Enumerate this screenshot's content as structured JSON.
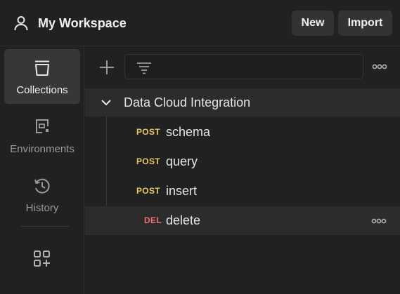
{
  "header": {
    "workspace_icon": "user-icon",
    "title": "My Workspace",
    "new_label": "New",
    "import_label": "Import"
  },
  "rail": {
    "items": [
      {
        "label": "Collections",
        "icon": "collection-icon",
        "active": true
      },
      {
        "label": "Environments",
        "icon": "environment-icon",
        "active": false
      },
      {
        "label": "History",
        "icon": "history-icon",
        "active": false
      }
    ],
    "apps_icon": "add-apps-icon"
  },
  "toolbar": {
    "add_icon": "plus-icon",
    "filter_icon": "filter-icon",
    "filter_value": "",
    "more_icon": "more-icon"
  },
  "collection": {
    "name": "Data Cloud Integration",
    "expanded": true,
    "requests": [
      {
        "method": "POST",
        "name": "schema"
      },
      {
        "method": "POST",
        "name": "query"
      },
      {
        "method": "POST",
        "name": "insert"
      },
      {
        "method": "DEL",
        "name": "delete"
      }
    ]
  },
  "colors": {
    "background": "#212121",
    "selected": "#373737",
    "row_highlight": "#2c2c2c",
    "post": "#e8c763",
    "delete": "#e57373"
  }
}
